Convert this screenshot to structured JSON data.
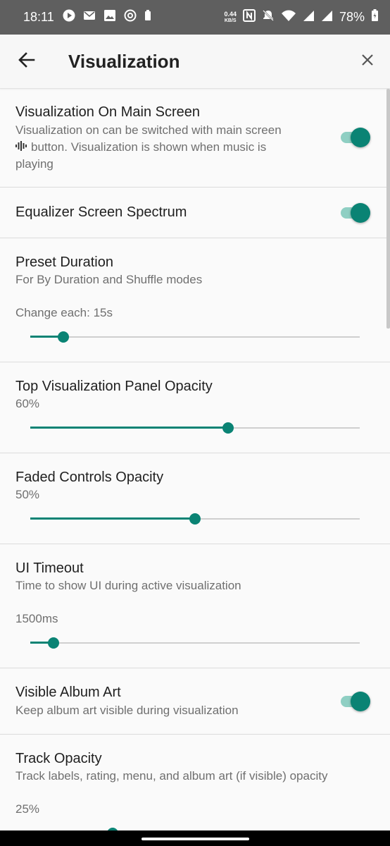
{
  "status_bar": {
    "time": "18:11",
    "net_speed_value": "0.44",
    "net_speed_unit": "KB/S",
    "battery": "78%",
    "icons_left": [
      "play-icon",
      "mail-icon",
      "image-icon",
      "at-icon",
      "battery-small-icon"
    ],
    "icons_right": [
      "nfc-icon",
      "mute-icon",
      "wifi-icon",
      "signal-icon",
      "signal-icon",
      "battery-icon"
    ]
  },
  "app_bar": {
    "title": "Visualization",
    "back_icon": "arrow-left-icon",
    "close_icon": "close-icon"
  },
  "settings": {
    "viz_main": {
      "title": "Visualization On Main Screen",
      "desc_1": "Visualization on can be switched with main screen",
      "desc_2": "button. Visualization is shown when music is",
      "desc_3": "playing",
      "enabled": true
    },
    "eq_spectrum": {
      "title": "Equalizer Screen Spectrum",
      "enabled": true
    },
    "preset_duration": {
      "title": "Preset Duration",
      "desc": "For By Duration and Shuffle modes",
      "value_label": "Change each: 15s",
      "level": 0.1
    },
    "top_panel_opacity": {
      "title": "Top Visualization Panel Opacity",
      "value_label": "60%",
      "level": 0.6
    },
    "faded_controls": {
      "title": "Faded Controls Opacity",
      "value_label": "50%",
      "level": 0.5
    },
    "ui_timeout": {
      "title": "UI Timeout",
      "desc": "Time to show UI during active visualization",
      "value_label": "1500ms",
      "level": 0.07
    },
    "album_art": {
      "title": "Visible Album Art",
      "desc": "Keep album art visible during visualization",
      "enabled": true
    },
    "track_opacity": {
      "title": "Track Opacity",
      "desc": "Track labels, rating, menu, and album art (if visible) opacity",
      "value_label": "25%",
      "level": 0.25
    }
  },
  "colors": {
    "accent": "#0a8374",
    "accent_light": "#8fcfc3",
    "status_bar": "#5f5f5f",
    "background": "#fafafa"
  }
}
